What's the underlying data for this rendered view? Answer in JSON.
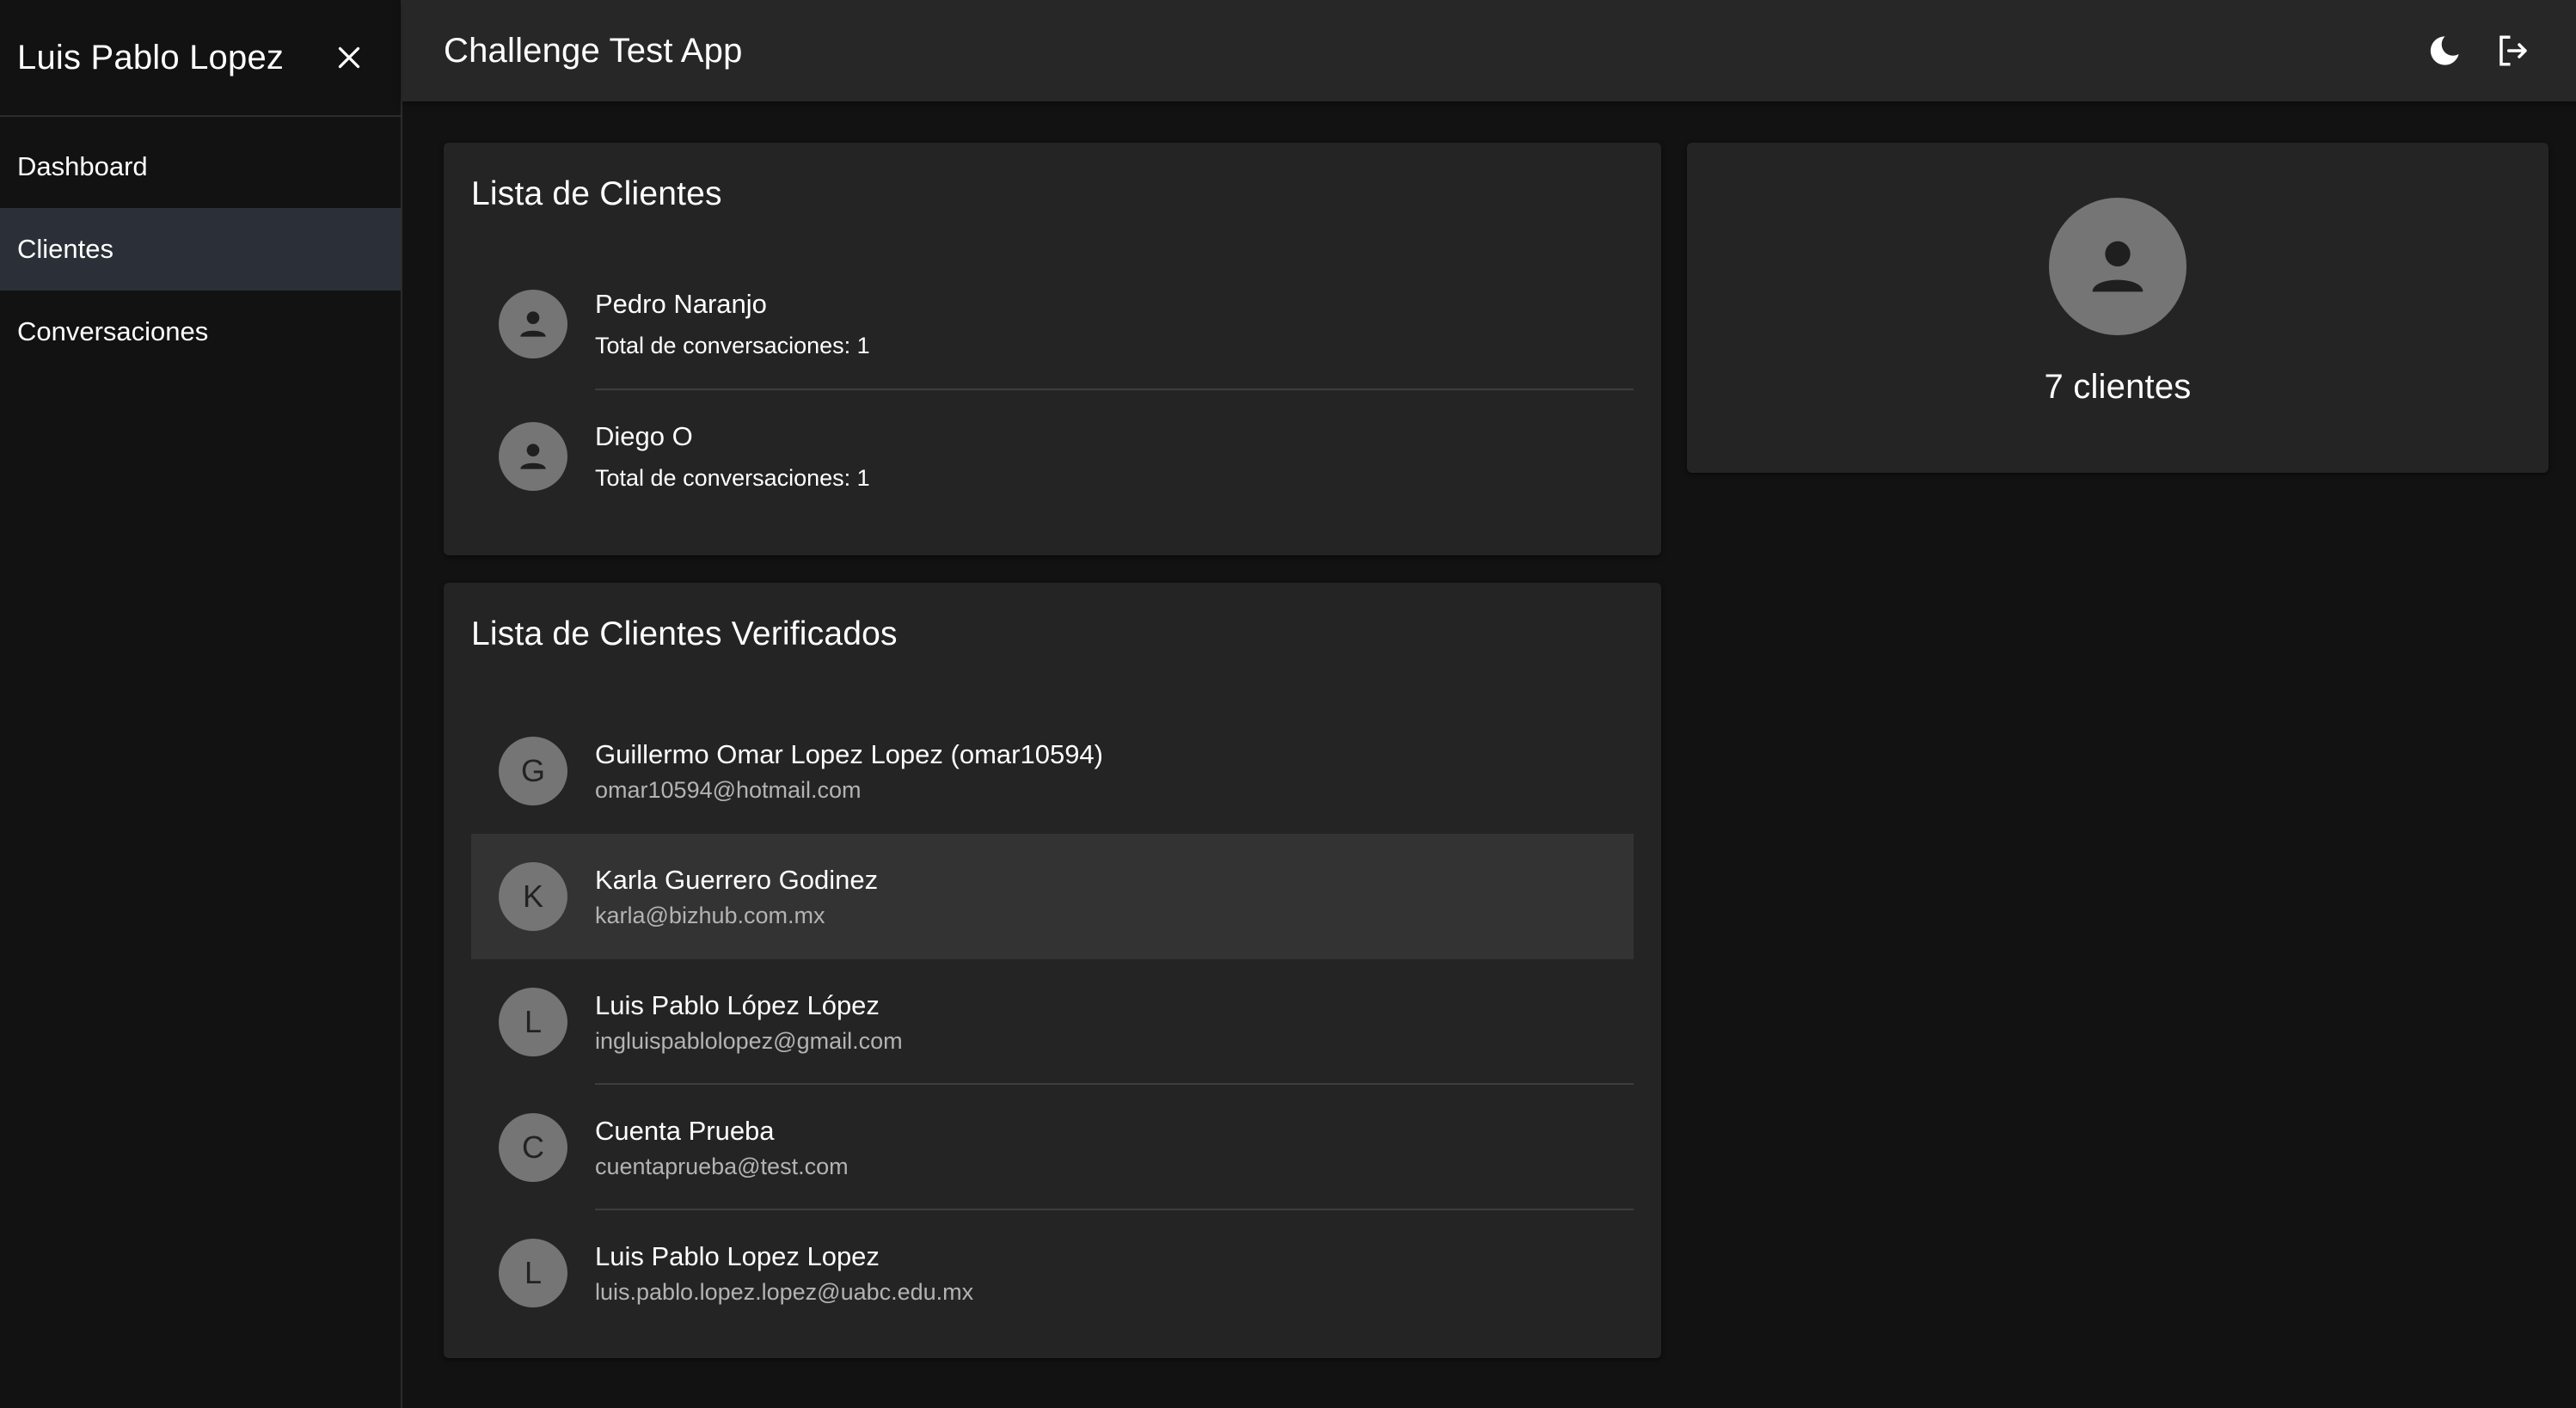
{
  "sidebar": {
    "user_name": "Luis Pablo Lopez",
    "close_icon": "close-icon",
    "items": [
      {
        "label": "Dashboard",
        "active": false
      },
      {
        "label": "Clientes",
        "active": true
      },
      {
        "label": "Conversaciones",
        "active": false
      }
    ]
  },
  "topbar": {
    "title": "Challenge Test App",
    "theme_icon": "dark-mode-moon-icon",
    "logout_icon": "logout-icon"
  },
  "clients_card": {
    "title": "Lista de Clientes",
    "items": [
      {
        "name": "Pedro Naranjo",
        "detail": "Total de conversaciones: 1"
      },
      {
        "name": "Diego O",
        "detail": "Total de conversaciones: 1"
      }
    ]
  },
  "verified_card": {
    "title": "Lista de Clientes Verificados",
    "items": [
      {
        "initial": "G",
        "name": "Guillermo Omar Lopez Lopez (omar10594)",
        "email": "omar10594@hotmail.com",
        "highlighted": false
      },
      {
        "initial": "K",
        "name": "Karla Guerrero Godinez",
        "email": "karla@bizhub.com.mx",
        "highlighted": true
      },
      {
        "initial": "L",
        "name": "Luis Pablo López López",
        "email": "ingluispablolopez@gmail.com",
        "highlighted": false
      },
      {
        "initial": "C",
        "name": "Cuenta Prueba",
        "email": "cuentaprueba@test.com",
        "highlighted": false
      },
      {
        "initial": "L",
        "name": "Luis Pablo Lopez Lopez",
        "email": "luis.pablo.lopez.lopez@uabc.edu.mx",
        "highlighted": false
      }
    ]
  },
  "count_card": {
    "icon": "person-icon",
    "text": "7 clientes"
  },
  "colors": {
    "background": "#121212",
    "surface": "#242424",
    "appbar": "#272727",
    "active_nav": "#2b3038",
    "avatar": "#757575"
  }
}
